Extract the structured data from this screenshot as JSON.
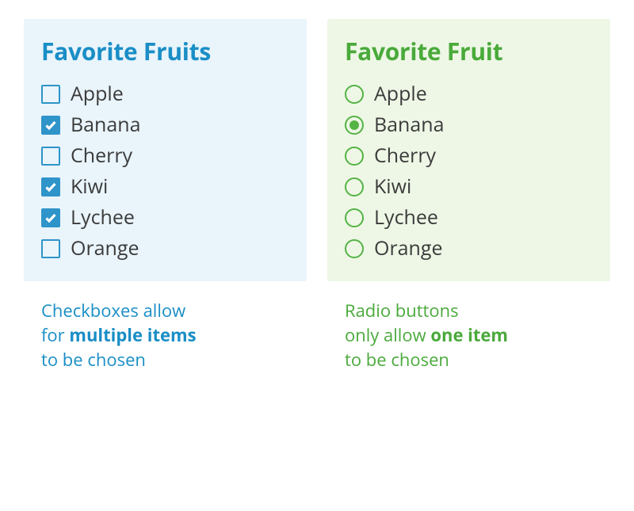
{
  "colors": {
    "blue": "#1a8ec6",
    "blue_fill": "#2e94c9",
    "green": "#4aaa3b",
    "green_fill": "#54b345"
  },
  "left": {
    "title": "Favorite Fruits",
    "items": [
      {
        "label": "Apple",
        "checked": false
      },
      {
        "label": "Banana",
        "checked": true
      },
      {
        "label": "Cherry",
        "checked": false
      },
      {
        "label": "Kiwi",
        "checked": true
      },
      {
        "label": "Lychee",
        "checked": true
      },
      {
        "label": "Orange",
        "checked": false
      }
    ],
    "caption": {
      "line1a": "Checkboxes allow",
      "line2a": "for ",
      "line2b_bold": "multiple items",
      "line3a": "to be chosen"
    }
  },
  "right": {
    "title": "Favorite Fruit",
    "items": [
      {
        "label": "Apple",
        "checked": false
      },
      {
        "label": "Banana",
        "checked": true
      },
      {
        "label": "Cherry",
        "checked": false
      },
      {
        "label": "Kiwi",
        "checked": false
      },
      {
        "label": "Lychee",
        "checked": false
      },
      {
        "label": "Orange",
        "checked": false
      }
    ],
    "caption": {
      "line1a": "Radio buttons",
      "line2a": "only allow ",
      "line2b_bold": "one item",
      "line3a": "to be chosen"
    }
  }
}
